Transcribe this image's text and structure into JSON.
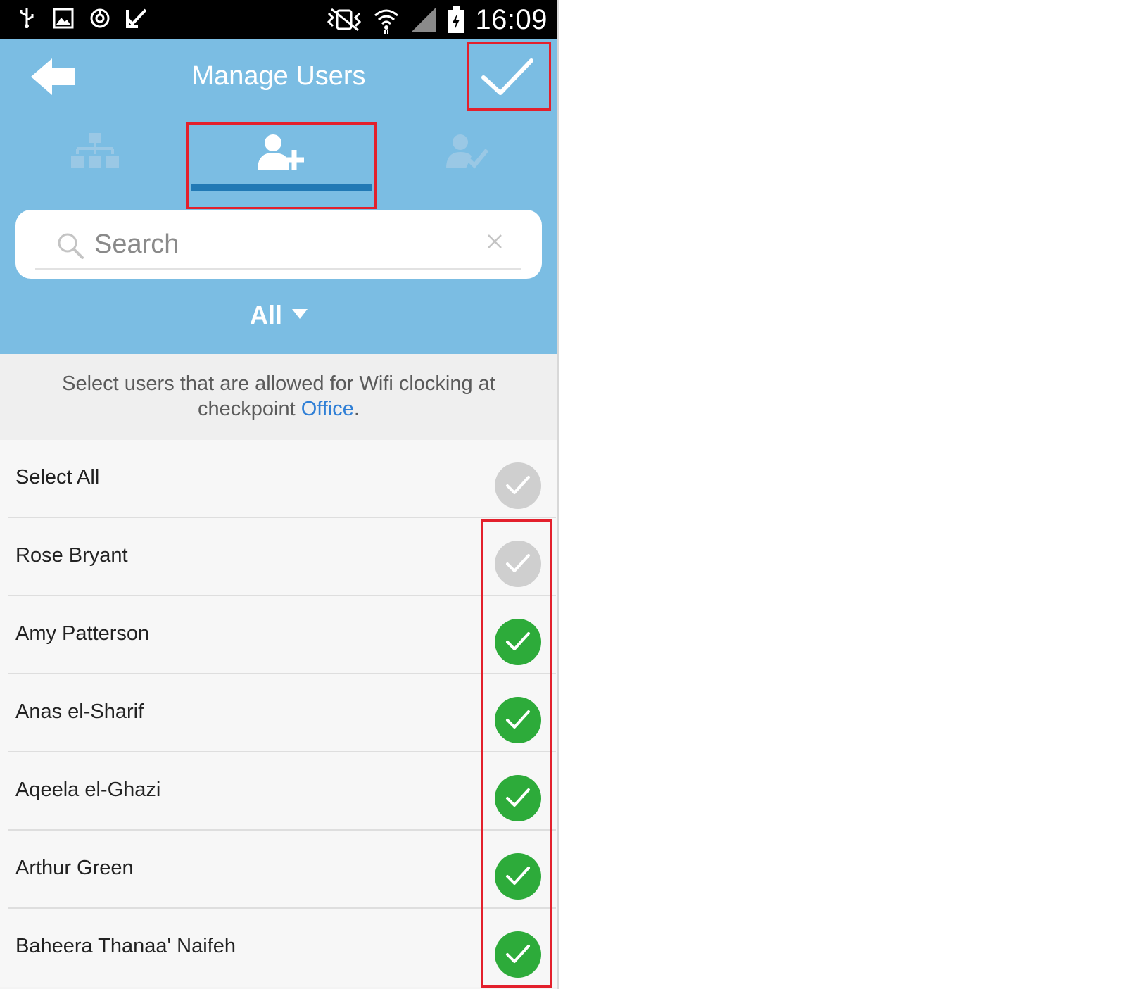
{
  "status_bar": {
    "time": "16:09",
    "icons": [
      "usb-icon",
      "image-icon",
      "sync-icon",
      "task-check-icon",
      "vibrate-icon",
      "wifi-icon",
      "signal-icon",
      "battery-charging-icon"
    ]
  },
  "header": {
    "title": "Manage Users",
    "back_icon": "back-arrow-icon",
    "confirm_icon": "checkmark-icon"
  },
  "tabs": [
    {
      "icon": "hierarchy-icon",
      "active": false
    },
    {
      "icon": "add-user-icon",
      "active": true
    },
    {
      "icon": "user-check-icon",
      "active": false
    }
  ],
  "search": {
    "placeholder": "Search",
    "value": ""
  },
  "filter": {
    "selected": "All"
  },
  "info": {
    "text_before": "Select users that are allowed for Wifi clocking at checkpoint ",
    "checkpoint": "Office",
    "text_after": "."
  },
  "list": {
    "select_all": {
      "label": "Select All",
      "checked": false
    },
    "users": [
      {
        "name": "Rose Bryant",
        "checked": false
      },
      {
        "name": "Amy Patterson",
        "checked": true
      },
      {
        "name": "Anas el-Sharif",
        "checked": true
      },
      {
        "name": "Aqeela el-Ghazi",
        "checked": true
      },
      {
        "name": "Arthur Green",
        "checked": true
      },
      {
        "name": "Baheera Thanaa' Naifeh",
        "checked": true
      }
    ]
  },
  "colors": {
    "header": "#7bbde3",
    "tab_underline": "#2179b5",
    "checked": "#2dab3a",
    "unchecked": "#cfcfcf",
    "highlight": "#e3202c",
    "link": "#2f7fd6"
  }
}
